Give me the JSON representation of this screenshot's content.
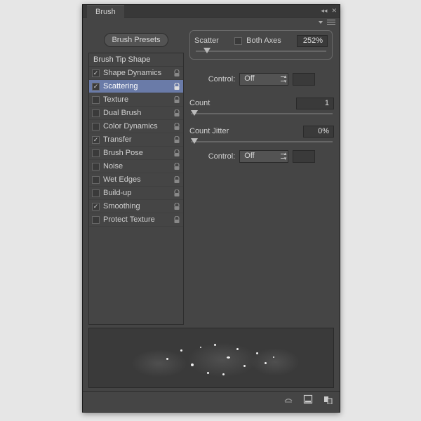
{
  "panel": {
    "title": "Brush"
  },
  "sidebar": {
    "presets_button": "Brush Presets",
    "tip_shape_header": "Brush Tip Shape",
    "options": [
      {
        "label": "Shape Dynamics",
        "checked": true,
        "lock": true,
        "selected": false
      },
      {
        "label": "Scattering",
        "checked": true,
        "lock": true,
        "selected": true
      },
      {
        "label": "Texture",
        "checked": false,
        "lock": true,
        "selected": false
      },
      {
        "label": "Dual Brush",
        "checked": false,
        "lock": true,
        "selected": false
      },
      {
        "label": "Color Dynamics",
        "checked": false,
        "lock": true,
        "selected": false
      },
      {
        "label": "Transfer",
        "checked": true,
        "lock": true,
        "selected": false
      },
      {
        "label": "Brush Pose",
        "checked": false,
        "lock": true,
        "selected": false
      },
      {
        "label": "Noise",
        "checked": false,
        "lock": true,
        "selected": false
      },
      {
        "label": "Wet Edges",
        "checked": false,
        "lock": true,
        "selected": false
      },
      {
        "label": "Build-up",
        "checked": false,
        "lock": true,
        "selected": false
      },
      {
        "label": "Smoothing",
        "checked": true,
        "lock": true,
        "selected": false
      },
      {
        "label": "Protect Texture",
        "checked": false,
        "lock": true,
        "selected": false
      }
    ]
  },
  "settings": {
    "scatter": {
      "label": "Scatter",
      "both_axes_label": "Both Axes",
      "both_axes_checked": false,
      "value": "252%",
      "slider_pct": 6
    },
    "control1": {
      "label": "Control:",
      "value": "Off"
    },
    "count": {
      "label": "Count",
      "value": "1",
      "slider_pct": 0
    },
    "count_jitter": {
      "label": "Count Jitter",
      "value": "0%",
      "slider_pct": 0
    },
    "control2": {
      "label": "Control:",
      "value": "Off"
    }
  }
}
